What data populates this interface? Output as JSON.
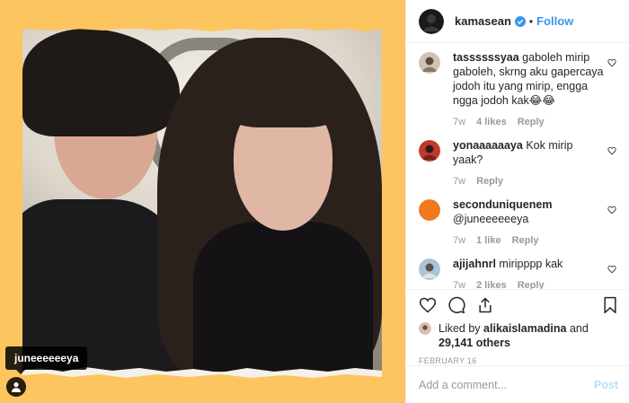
{
  "header": {
    "username": "kamasean",
    "separator": "•",
    "follow_label": "Follow",
    "verified_icon": "verified-badge-icon"
  },
  "photo": {
    "tagged_user": "juneeeeeeya",
    "tag_icon": "user-tag-icon",
    "background_color": "#fdc55f"
  },
  "comments": [
    {
      "user": "tassssssyaa",
      "text": "gaboleh mirip gaboleh, skrng aku gapercaya jodoh itu yang mirip, engga ngga jodoh kak😂😂",
      "time": "7w",
      "likes": "4 likes",
      "reply": "Reply"
    },
    {
      "user": "yonaaaaaaya",
      "text": "Kok mirip yaak?",
      "time": "7w",
      "likes": "",
      "reply": "Reply"
    },
    {
      "user": "seconduniquenem",
      "text": "@juneeeeeeya",
      "time": "7w",
      "likes": "1 like",
      "reply": "Reply"
    },
    {
      "user": "ajijahnrl",
      "text": "miripppp kak",
      "time": "7w",
      "likes": "2 likes",
      "reply": "Reply"
    }
  ],
  "likes": {
    "prefix": "Liked by",
    "user": "alikaislamadina",
    "and": "and",
    "count": "29,141 others"
  },
  "date": "FEBRUARY 16",
  "add_comment": {
    "placeholder": "Add a comment...",
    "post_label": "Post"
  },
  "colors": {
    "link_blue": "#3897f0",
    "post_disabled": "#b2dffc",
    "muted": "#999999"
  }
}
